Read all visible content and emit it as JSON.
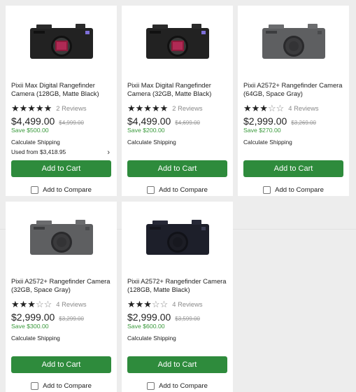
{
  "products": [
    {
      "title": "Pixii Max Digital Rangefinder Camera (128GB, Matte Black)",
      "stars_full": "★★★★★",
      "stars_empty": "",
      "reviews": "2 Reviews",
      "price": "$4,499.00",
      "old_price": "$4,999.00",
      "save": "Save $500.00",
      "shipping": "Calculate Shipping",
      "used": "Used from $3,418.95",
      "cart": "Add to Cart",
      "compare": "Add to Compare",
      "camera_color": "#222222",
      "lens": "red"
    },
    {
      "title": "Pixii Max Digital Rangefinder Camera (32GB, Matte Black)",
      "stars_full": "★★★★★",
      "stars_empty": "",
      "reviews": "2 Reviews",
      "price": "$4,499.00",
      "old_price": "$4,699.00",
      "save": "Save $200.00",
      "shipping": "Calculate Shipping",
      "cart": "Add to Cart",
      "compare": "Add to Compare",
      "camera_color": "#222222",
      "lens": "red"
    },
    {
      "title": "Pixii A2572+ Rangefinder Camera (64GB, Space Gray)",
      "stars_full": "★★★",
      "stars_empty": "☆☆",
      "reviews": "4 Reviews",
      "price": "$2,999.00",
      "old_price": "$3,269.00",
      "save": "Save $270.00",
      "shipping": "Calculate Shipping",
      "cart": "Add to Cart",
      "compare": "Add to Compare",
      "camera_color": "#5e5f61",
      "lens": "cap"
    },
    {
      "title": "Pixii A2572+ Rangefinder Camera (32GB, Space Gray)",
      "stars_full": "★★★",
      "stars_empty": "☆☆",
      "reviews": "4 Reviews",
      "price": "$2,999.00",
      "old_price": "$3,299.00",
      "save": "Save $300.00",
      "shipping": "Calculate Shipping",
      "cart": "Add to Cart",
      "compare": "Add to Compare",
      "camera_color": "#5e5f61",
      "lens": "cap"
    },
    {
      "title": "Pixii A2572+ Rangefinder Camera (128GB, Matte Black)",
      "stars_full": "★★★",
      "stars_empty": "☆☆",
      "reviews": "4 Reviews",
      "price": "$2,999.00",
      "old_price": "$3,599.00",
      "save": "Save $600.00",
      "shipping": "Calculate Shipping",
      "cart": "Add to Cart",
      "compare": "Add to Compare",
      "camera_color": "#1d1f2a",
      "lens": "cap"
    }
  ]
}
